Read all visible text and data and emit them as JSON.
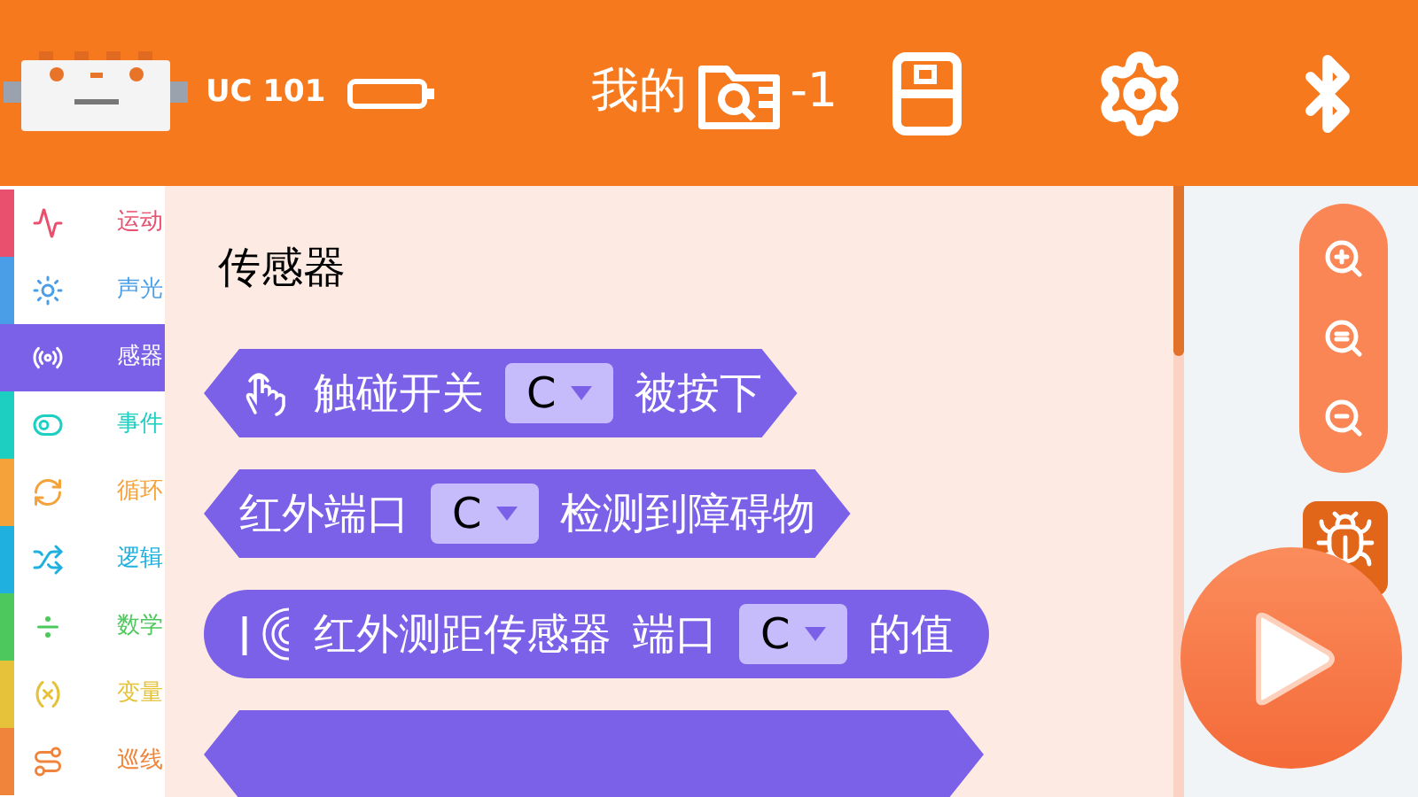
{
  "header": {
    "device_name": "UC 101",
    "title_start": "我的",
    "title_end": "-1"
  },
  "categories": [
    {
      "label": "运动",
      "kind": "motion",
      "color": "#e8506e",
      "selected": false
    },
    {
      "label": "声光",
      "kind": "sound-light",
      "color": "#4a9ee8",
      "selected": false
    },
    {
      "label": "感器",
      "kind": "sensor",
      "color": "#7b61e8",
      "selected": true
    },
    {
      "label": "事件",
      "kind": "event",
      "color": "#1ccfc0",
      "selected": false
    },
    {
      "label": "循环",
      "kind": "loop",
      "color": "#f5a23a",
      "selected": false
    },
    {
      "label": "逻辑",
      "kind": "logic",
      "color": "#1fb0e0",
      "selected": false
    },
    {
      "label": "数学",
      "kind": "math",
      "color": "#4cc85c",
      "selected": false
    },
    {
      "label": "变量",
      "kind": "variable",
      "color": "#e5c23a",
      "selected": false
    },
    {
      "label": "巡线",
      "kind": "line",
      "color": "#f0843a",
      "selected": false
    }
  ],
  "palette": {
    "heading": "传感器",
    "blocks": [
      {
        "kind": "touch",
        "parts": [
          {
            "kind": "text",
            "text": "触碰开关"
          },
          {
            "kind": "dropdown",
            "text": "C"
          },
          {
            "kind": "text",
            "text": "被按下"
          }
        ]
      },
      {
        "kind": "boolean",
        "parts": [
          {
            "kind": "text",
            "text": "红外端口"
          },
          {
            "kind": "dropdown",
            "text": "C"
          },
          {
            "kind": "text",
            "text": "检测到障碍物"
          }
        ]
      },
      {
        "kind": "ranging",
        "parts": [
          {
            "kind": "text",
            "text": "红外测距传感器"
          },
          {
            "kind": "text",
            "text": "端口"
          },
          {
            "kind": "dropdown",
            "text": "C"
          },
          {
            "kind": "text",
            "text": "的值"
          }
        ]
      },
      {
        "kind": "boolean"
      }
    ]
  }
}
